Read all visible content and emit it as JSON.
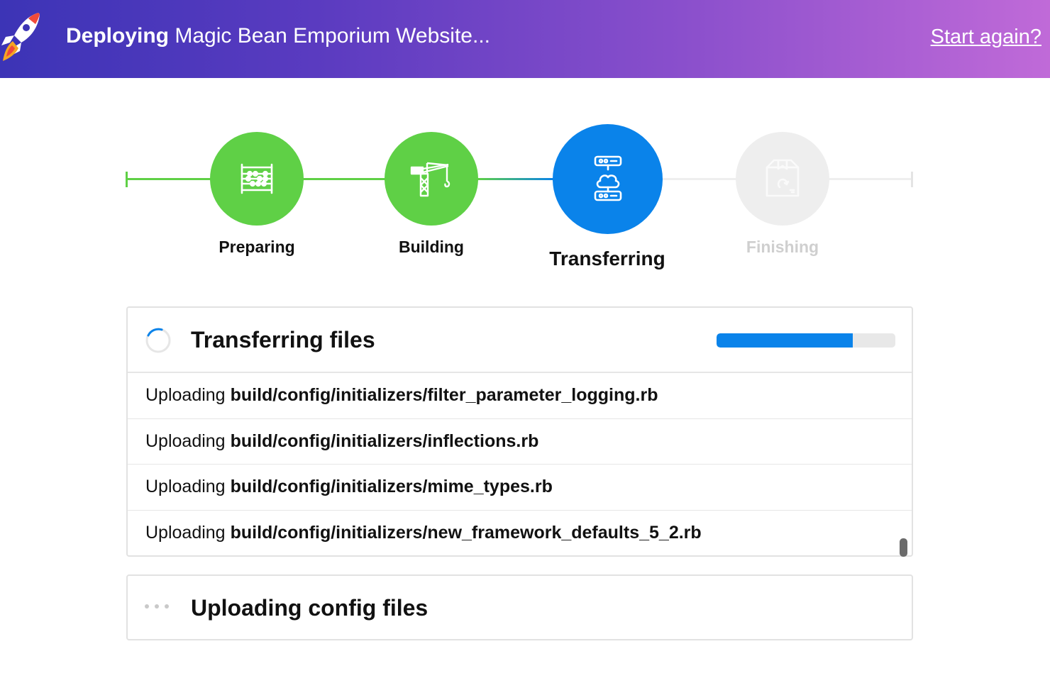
{
  "header": {
    "title_strong": "Deploying",
    "title_rest": "Magic Bean Emporium Website...",
    "start_again": "Start again?"
  },
  "steps": [
    {
      "label": "Preparing",
      "status": "complete",
      "icon": "abacus-icon"
    },
    {
      "label": "Building",
      "status": "complete",
      "icon": "crane-icon"
    },
    {
      "label": "Transferring",
      "status": "active",
      "icon": "cloud-server-icon"
    },
    {
      "label": "Finishing",
      "status": "pending",
      "icon": "package-icon"
    }
  ],
  "colors": {
    "complete": "#5fd046",
    "active": "#0a83ea",
    "pending": "#eeeeee",
    "pending_text": "#cfcfcf"
  },
  "transfer": {
    "title": "Transferring files",
    "progress_percent": 76,
    "rows": [
      {
        "verb": "Uploading",
        "path": "build/config/initializers/filter_parameter_logging.rb"
      },
      {
        "verb": "Uploading",
        "path": "build/config/initializers/inflections.rb"
      },
      {
        "verb": "Uploading",
        "path": "build/config/initializers/mime_types.rb"
      },
      {
        "verb": "Uploading",
        "path": "build/config/initializers/new_framework_defaults_5_2.rb"
      }
    ]
  },
  "upload_config": {
    "title": "Uploading config files"
  }
}
